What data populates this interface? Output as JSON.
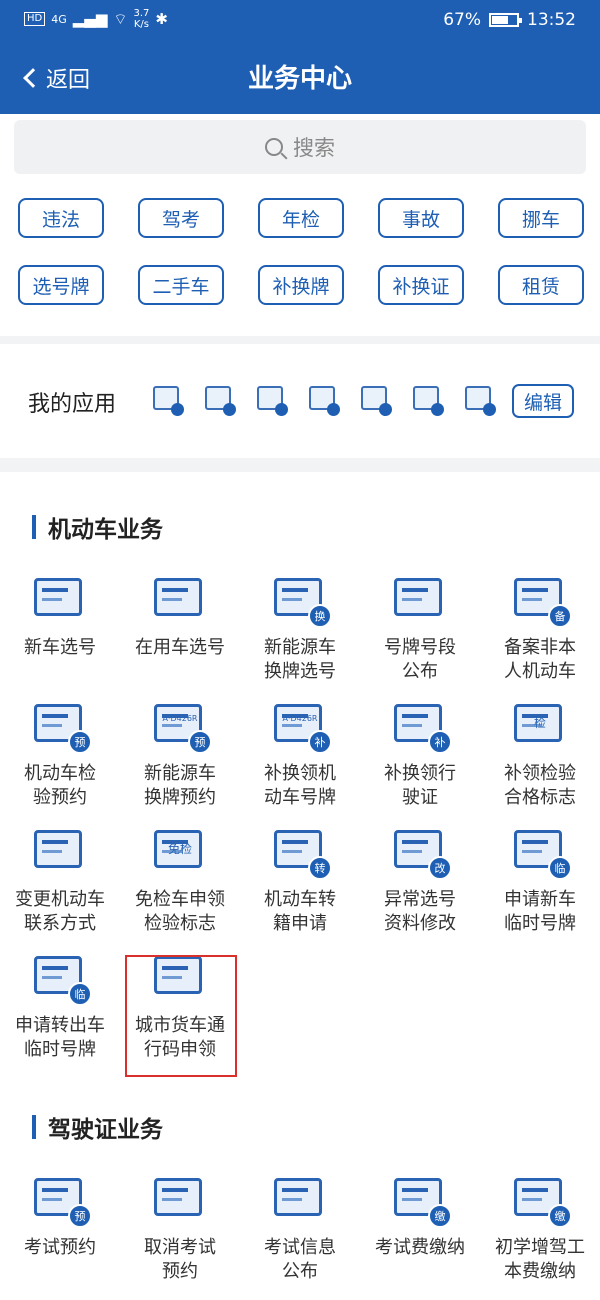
{
  "status_bar": {
    "hd": "HD",
    "network": "4G",
    "speed_value": "3.7",
    "speed_unit": "K/s",
    "battery_percent": "67%",
    "battery_level": 0.67,
    "time": "13:52"
  },
  "header": {
    "back_label": "返回",
    "title": "业务中心"
  },
  "search": {
    "placeholder": "搜索"
  },
  "quick_tags": [
    "违法",
    "驾考",
    "年检",
    "事故",
    "挪车",
    "选号牌",
    "二手车",
    "补换牌",
    "补换证",
    "租赁"
  ],
  "my_apps": {
    "label": "我的应用",
    "icons": [
      "car-icon",
      "scroll-icon",
      "id-card-icon",
      "chat-icon",
      "vehicle-card-icon",
      "list-icon",
      "license-icon"
    ],
    "edit_label": "编辑"
  },
  "vehicle_section": {
    "title": "机动车业务",
    "items": [
      {
        "line1": "新车选号",
        "line2": "",
        "badge": ""
      },
      {
        "line1": "在用车选号",
        "line2": "",
        "badge": ""
      },
      {
        "line1": "新能源车",
        "line2": "换牌选号",
        "badge": "换"
      },
      {
        "line1": "号牌号段",
        "line2": "公布",
        "badge": ""
      },
      {
        "line1": "备案非本",
        "line2": "人机动车",
        "badge": "备"
      },
      {
        "line1": "机动车检",
        "line2": "验预约",
        "badge": "预"
      },
      {
        "line1": "新能源车",
        "line2": "换牌预约",
        "badge": "预"
      },
      {
        "line1": "补换领机",
        "line2": "动车号牌",
        "badge": "补"
      },
      {
        "line1": "补换领行",
        "line2": "驶证",
        "badge": "补"
      },
      {
        "line1": "补领检验",
        "line2": "合格标志",
        "badge": ""
      },
      {
        "line1": "变更机动车",
        "line2": "联系方式",
        "badge": ""
      },
      {
        "line1": "免检车申领",
        "line2": "检验标志",
        "badge": ""
      },
      {
        "line1": "机动车转",
        "line2": "籍申请",
        "badge": "转"
      },
      {
        "line1": "异常选号",
        "line2": "资料修改",
        "badge": "改"
      },
      {
        "line1": "申请新车",
        "line2": "临时号牌",
        "badge": "临"
      },
      {
        "line1": "申请转出车",
        "line2": "临时号牌",
        "badge": "临"
      },
      {
        "line1": "城市货车通",
        "line2": "行码申领",
        "badge": ""
      }
    ],
    "icon_texts": {
      "plate_sample": "A·D426R",
      "inspect": "检",
      "exempt": "免检"
    }
  },
  "license_section": {
    "title": "驾驶证业务",
    "items": [
      {
        "line1": "考试预约",
        "line2": "",
        "badge": "预"
      },
      {
        "line1": "取消考试",
        "line2": "预约",
        "badge": ""
      },
      {
        "line1": "考试信息",
        "line2": "公布",
        "badge": ""
      },
      {
        "line1": "考试费缴纳",
        "line2": "",
        "badge": "缴"
      },
      {
        "line1": "初学增驾工",
        "line2": "本费缴纳",
        "badge": "缴"
      }
    ]
  },
  "colors": {
    "brand": "#1e5fb4",
    "highlight": "#d9302c"
  }
}
